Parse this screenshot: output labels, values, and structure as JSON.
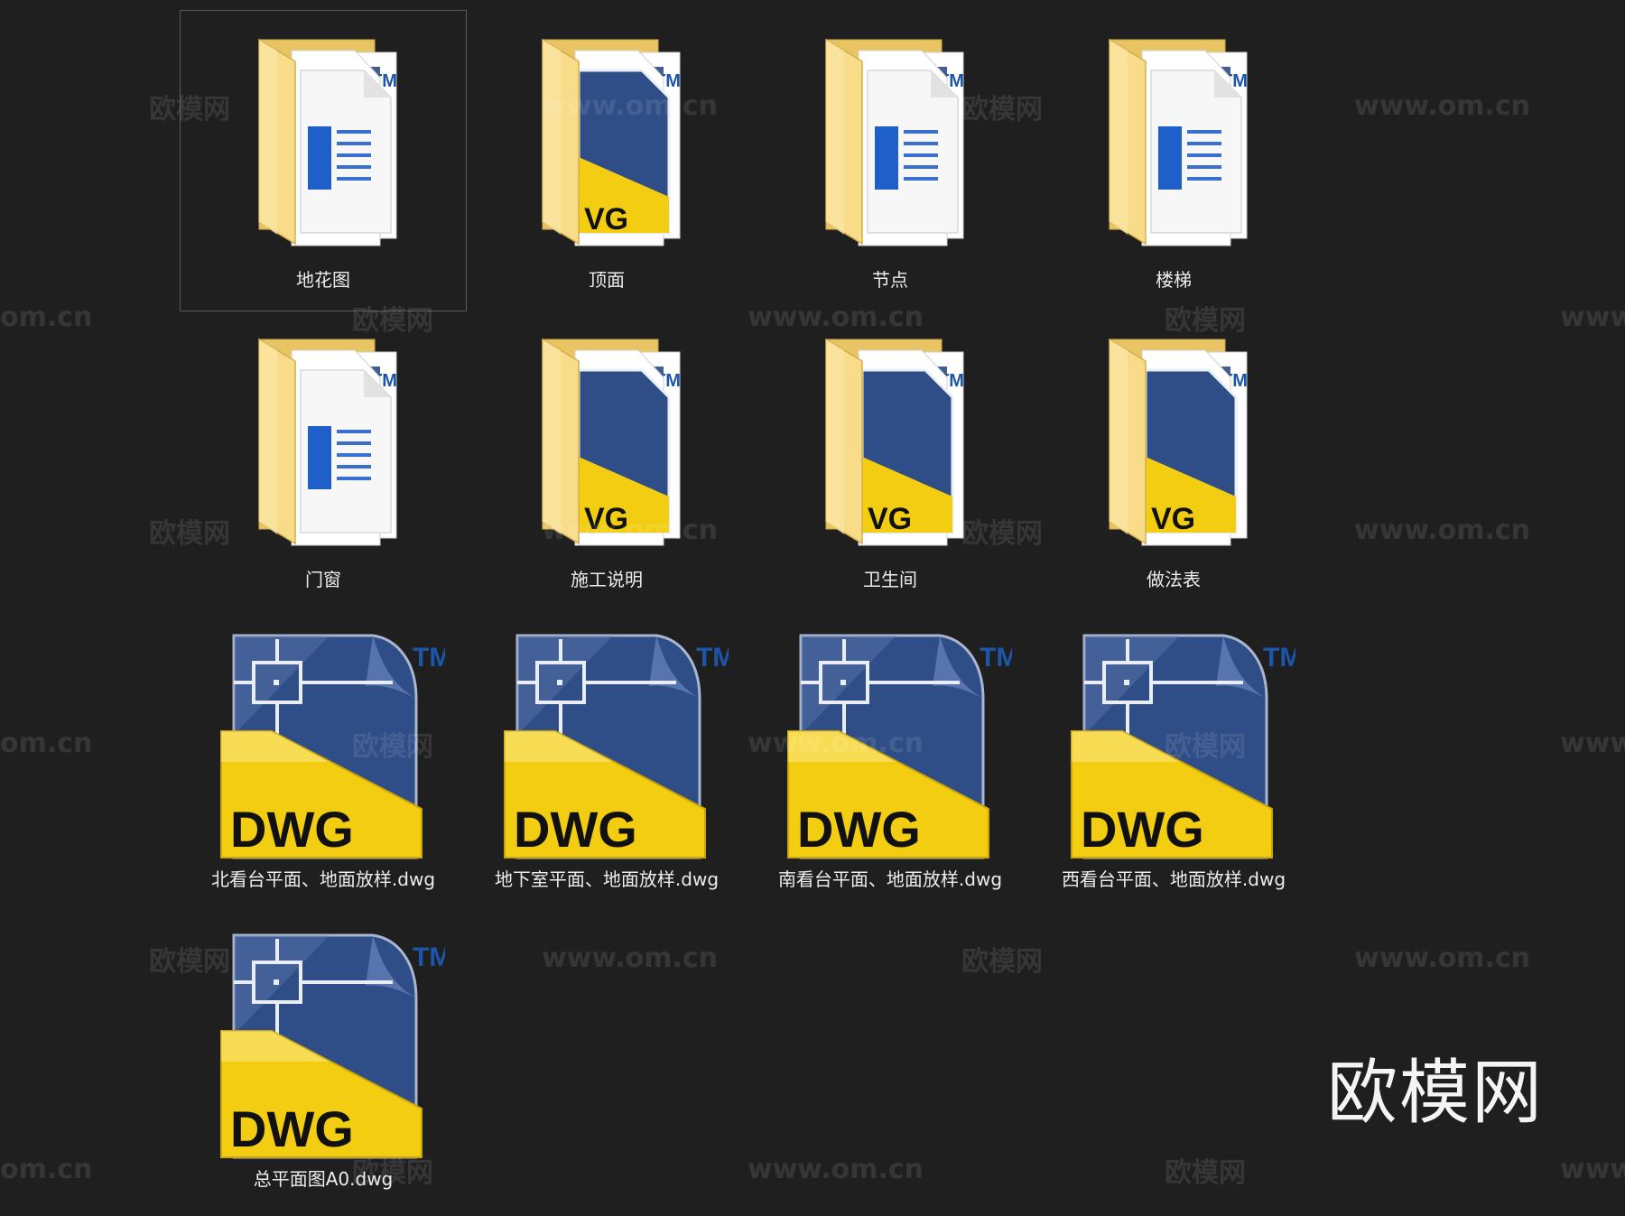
{
  "items": [
    {
      "label": "地花图",
      "kind": "folder",
      "doc": "word",
      "selected": true
    },
    {
      "label": "顶面",
      "kind": "folder",
      "doc": "dwg",
      "selected": false
    },
    {
      "label": "节点",
      "kind": "folder",
      "doc": "word",
      "selected": false
    },
    {
      "label": "楼梯",
      "kind": "folder",
      "doc": "word",
      "selected": false
    },
    {
      "label": "门窗",
      "kind": "folder",
      "doc": "word",
      "selected": false
    },
    {
      "label": "施工说明",
      "kind": "folder",
      "doc": "dwg",
      "selected": false
    },
    {
      "label": "卫生间",
      "kind": "folder",
      "doc": "dwg",
      "selected": false
    },
    {
      "label": "做法表",
      "kind": "folder",
      "doc": "dwg",
      "selected": false
    },
    {
      "label": "北看台平面、地面放样.dwg",
      "kind": "dwg",
      "selected": false
    },
    {
      "label": "地下室平面、地面放样.dwg",
      "kind": "dwg",
      "selected": false
    },
    {
      "label": "南看台平面、地面放样.dwg",
      "kind": "dwg",
      "selected": false
    },
    {
      "label": "西看台平面、地面放样.dwg",
      "kind": "dwg",
      "selected": false
    },
    {
      "label": "总平面图A0.dwg",
      "kind": "dwg",
      "selected": false
    }
  ],
  "icon_text": {
    "dwg": "DWG",
    "tm": "TM",
    "partial_dwg": "VG"
  },
  "watermark": {
    "brand": "欧模网",
    "url": "www.om.cn",
    "url_cut": "om.cn",
    "url_start": "www."
  },
  "colors": {
    "background": "#1f1f1f",
    "folder_back": "#e9c462",
    "folder_front": "#f8dc8a",
    "dwg_blue": "#2f4d86",
    "dwg_yellow": "#f2cd12",
    "tm_blue": "#1c56a8",
    "word_blue": "#1f5fc9",
    "label_text": "#ececec"
  }
}
